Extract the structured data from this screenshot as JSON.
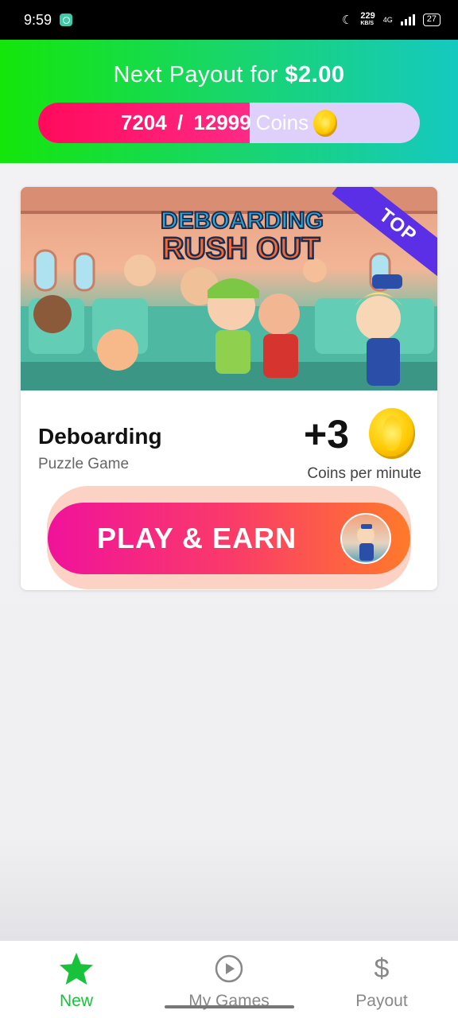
{
  "status_bar": {
    "time": "9:59",
    "speed_value": "229",
    "speed_unit": "KB/S",
    "network": "4G",
    "battery": "27"
  },
  "header": {
    "payout_prefix": "Next Payout for ",
    "payout_amount": "$2.00",
    "progress": {
      "current": "7204",
      "separator": " / ",
      "target": "12999",
      "unit": "Coins",
      "fraction": 0.554
    },
    "colors": {
      "gradient_start": "#14e60a",
      "gradient_end": "#15c9c0",
      "progress_fill": "#ff0a5c",
      "progress_track": "#ded0fb"
    }
  },
  "game_card": {
    "banner_title_line1": "DEBOARDING",
    "banner_title_line2": "RUSH OUT",
    "badge": "TOP",
    "name": "Deboarding",
    "genre": "Puzzle Game",
    "reward": "+3",
    "reward_caption": "Coins per minute",
    "play_button_label": "PLAY & EARN"
  },
  "bottom_nav": {
    "items": [
      {
        "label": "New",
        "icon": "star-icon",
        "active": true
      },
      {
        "label": "My Games",
        "icon": "play-circle-icon",
        "active": false
      },
      {
        "label": "Payout",
        "icon": "dollar-icon",
        "active": false
      }
    ],
    "active_color": "#18c23a"
  }
}
